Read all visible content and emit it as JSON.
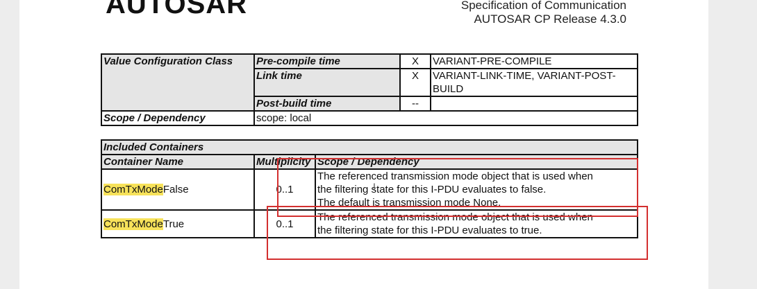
{
  "header": {
    "logo": "AUTOSAR",
    "title_line1": "Specification of Communication",
    "title_line2": "AUTOSAR CP Release 4.3.0"
  },
  "config_table": {
    "row_label": "Value Configuration Class",
    "rows": [
      {
        "time": "Pre-compile time",
        "mark": "X",
        "variant": "VARIANT-PRE-COMPILE"
      },
      {
        "time": "Link time",
        "mark": "X",
        "variant": "VARIANT-LINK-TIME, VARIANT-POST-BUILD"
      },
      {
        "time": "Post-build time",
        "mark": "--",
        "variant": ""
      }
    ],
    "scope_label": "Scope / Dependency",
    "scope_value": "scope: local"
  },
  "included_table": {
    "title": "Included Containers",
    "headers": [
      "Container Name",
      "Multiplicity",
      "Scope / Dependency"
    ],
    "rows": [
      {
        "name_highlight": "ComTxMode",
        "name_rest": "False",
        "multiplicity": "0..1",
        "description": [
          "The referenced transmission mode object that is used when",
          "the filtering state for this I-PDU evaluates to false.",
          "The default is transmission mode None."
        ]
      },
      {
        "name_highlight": "ComTxMode",
        "name_rest": "True",
        "multiplicity": "0..1",
        "description": [
          "The referenced transmission mode object that is used when",
          "the filtering state for this I-PDU evaluates to true."
        ]
      }
    ]
  },
  "colors": {
    "annotation": "#d32f2f",
    "highlight": "#f7e25a"
  }
}
